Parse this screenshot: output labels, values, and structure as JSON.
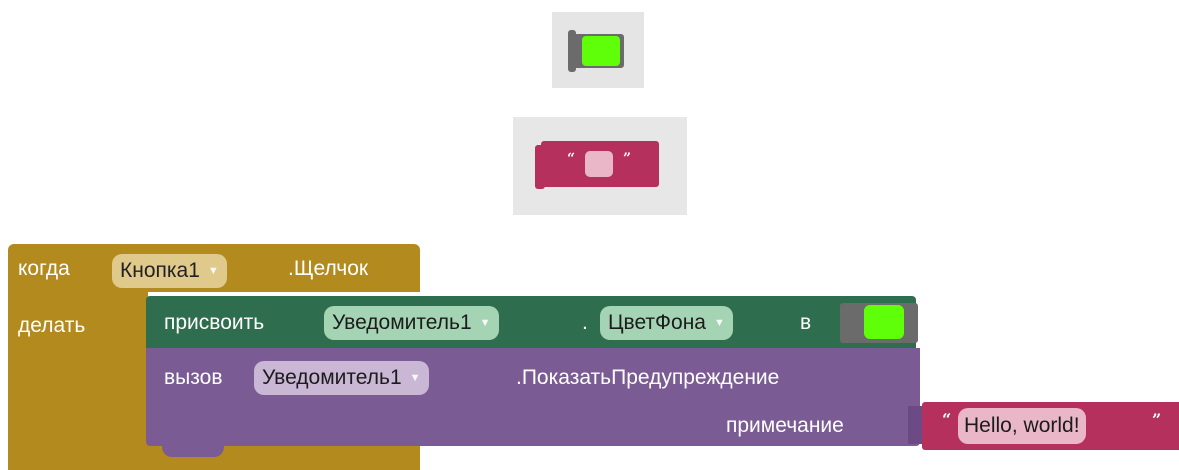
{
  "palette": {
    "color_tile": {
      "color": "#5fff0a"
    },
    "text_tile": {
      "open_quote": "“",
      "close_quote": "”"
    }
  },
  "event_block": {
    "when_label": "когда",
    "component": "Кнопка1",
    "event": ".Щелчок",
    "do_label": "делать"
  },
  "set_block": {
    "set_label": "присвоить",
    "component": "Уведомитель1",
    "dot": ".",
    "property": "ЦветФона",
    "to_label": "в",
    "color": "#5fff0a"
  },
  "call_block": {
    "call_label": "вызов",
    "component": "Уведомитель1",
    "method": ".ПоказатьПредупреждение",
    "param_label": "примечание"
  },
  "text_block": {
    "open_quote": "“",
    "value": "Hello, world!",
    "close_quote": "”"
  },
  "icons": {
    "dropdown": "dropdown-arrow-icon"
  }
}
